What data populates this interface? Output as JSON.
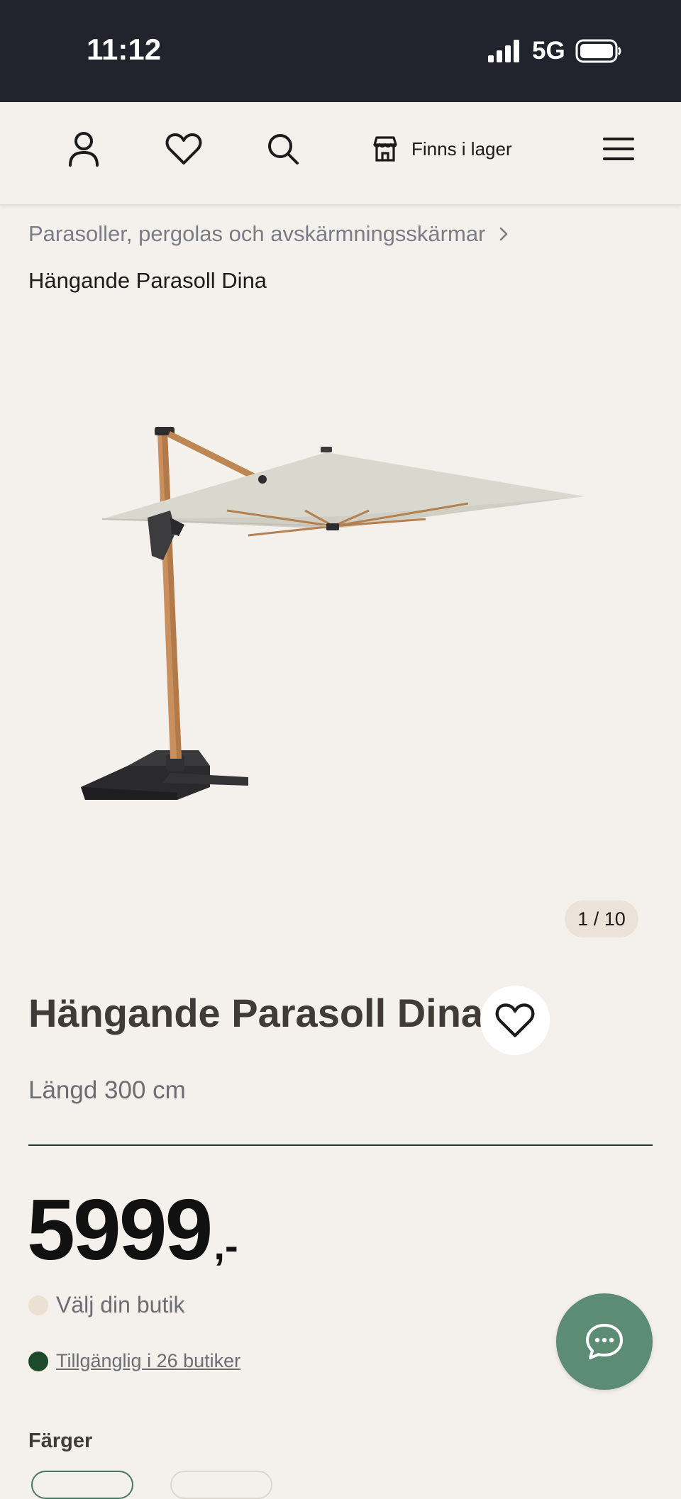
{
  "status_bar": {
    "time": "11:12",
    "network": "5G"
  },
  "nav": {
    "store_label": "Finns i lager"
  },
  "breadcrumb": {
    "parent": "Parasoller, pergolas och avskärmningsskärmar",
    "current": "Hängande Parasoll Dina"
  },
  "gallery": {
    "counter": "1 / 10"
  },
  "product": {
    "title": "Hängande Parasoll Dina",
    "length": "Längd 300 cm",
    "price": "5999",
    "price_suffix": ",-"
  },
  "availability": {
    "store_select": "Välj din butik",
    "available": "Tillgänglig i 26 butiker"
  },
  "colors": {
    "heading": "Färger"
  },
  "theme": {
    "status_bar_bg": "#22232c",
    "page_bg": "#f4f0eb",
    "accent_green": "#5c8c74",
    "stock_green": "#1d4a2b"
  }
}
